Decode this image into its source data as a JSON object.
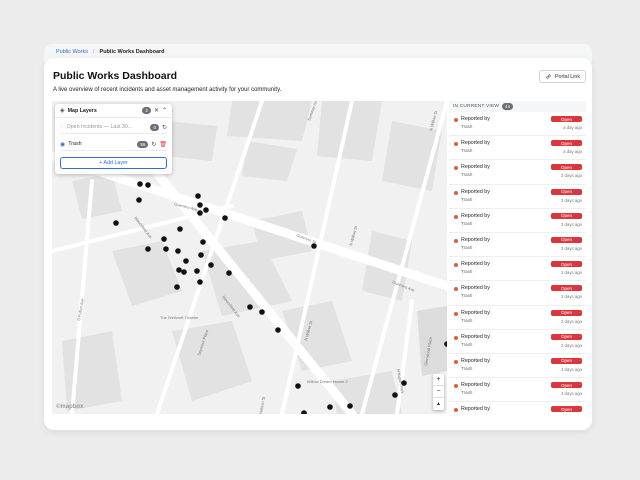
{
  "breadcrumb": {
    "parent": "Public Works",
    "separator": "/",
    "current": "Public Works Dashboard"
  },
  "header": {
    "title": "Public Works Dashboard",
    "subtitle": "A live overview of recent incidents and asset management activity for your community.",
    "portal_link_label": "Portal Link"
  },
  "layers_panel": {
    "title": "Map Layers",
    "count": "2",
    "layers": [
      {
        "name": "Open Incidents — Last 30...",
        "count": "0"
      },
      {
        "name": "Trash",
        "count": "55"
      }
    ],
    "add_label": "+ Add Layer"
  },
  "map": {
    "streets": {
      "s1": "Guerrero Ave",
      "s2": "Guerrero St",
      "s3": "Bloomfield Ave",
      "s4": "Bloomfield Ave",
      "s5": "N Willow St",
      "s6": "N Willow St",
      "s7": "N Willow St",
      "s8": "Guerrero Ave",
      "s9": "Summer Ave",
      "s10": "S Fulton Ave",
      "s11": "Seymour Place",
      "s12": "Glenwood Place",
      "s13": "Arlington Park",
      "s14": "Nelson St"
    },
    "pois": {
      "p1": "The Wellcroft Theatre",
      "p2": "Willow Dream House 2"
    },
    "zoom_in": "+",
    "zoom_out": "−",
    "compass": "▲",
    "attribution": "©mapbox"
  },
  "side": {
    "header": "IN CURRENT VIEW",
    "count": "44",
    "items": [
      {
        "reported": "Reported by",
        "category": "Trash",
        "status": "Open",
        "age": "a day ago"
      },
      {
        "reported": "Reported by",
        "category": "Trash",
        "status": "Open",
        "age": "a day ago"
      },
      {
        "reported": "Reported by",
        "category": "Trash",
        "status": "Open",
        "age": "2 days ago"
      },
      {
        "reported": "Reported by",
        "category": "Trash",
        "status": "Open",
        "age": "2 days ago"
      },
      {
        "reported": "Reported by",
        "category": "Trash",
        "status": "Open",
        "age": "2 days ago"
      },
      {
        "reported": "Reported by",
        "category": "Trash",
        "status": "Open",
        "age": "2 days ago"
      },
      {
        "reported": "Reported by",
        "category": "Trash",
        "status": "Open",
        "age": "2 days ago"
      },
      {
        "reported": "Reported by",
        "category": "Trash",
        "status": "Open",
        "age": "2 days ago"
      },
      {
        "reported": "Reported by",
        "category": "Trash",
        "status": "Open",
        "age": "2 days ago"
      },
      {
        "reported": "Reported by",
        "category": "Trash",
        "status": "Open",
        "age": "2 days ago"
      },
      {
        "reported": "Reported by",
        "category": "Trash",
        "status": "Open",
        "age": "4 days ago"
      },
      {
        "reported": "Reported by",
        "category": "Trash",
        "status": "Open",
        "age": "4 days ago"
      },
      {
        "reported": "Reported by",
        "category": "Trash",
        "status": "Open",
        "age": "4 days ago"
      }
    ]
  },
  "colors": {
    "accent": "#2f6fd6",
    "status_open": "#d9363e",
    "bullet": "#e25c3b"
  }
}
